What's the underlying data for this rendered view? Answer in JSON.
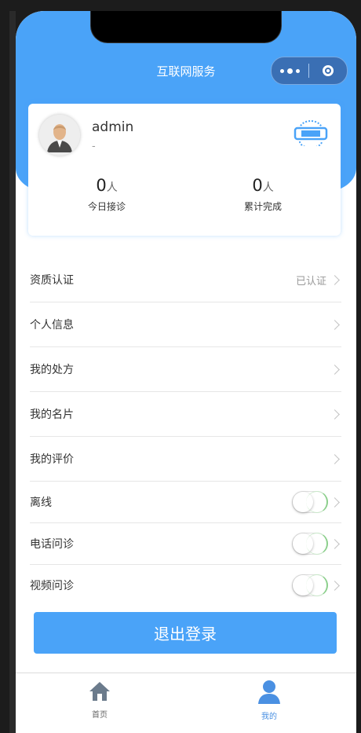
{
  "header": {
    "title": "互联网服务"
  },
  "capsule": {
    "more_icon": "more-dots-icon",
    "close_icon": "target-circle-icon"
  },
  "profile": {
    "username": "admin",
    "subtitle": "-",
    "badge_icon": "verified-badge-icon",
    "stats": [
      {
        "value": "0",
        "unit": "人",
        "label": "今日接诊"
      },
      {
        "value": "0",
        "unit": "人",
        "label": "累计完成"
      }
    ]
  },
  "menu": {
    "items": [
      {
        "label": "资质认证",
        "value": "已认证"
      },
      {
        "label": "个人信息"
      },
      {
        "label": "我的处方"
      },
      {
        "label": "我的名片"
      },
      {
        "label": "我的评价"
      },
      {
        "label": "离线"
      },
      {
        "label": "电话问诊"
      },
      {
        "label": "视频问诊"
      }
    ]
  },
  "logout": {
    "label": "退出登录"
  },
  "tabbar": {
    "items": [
      {
        "label": "首页",
        "icon": "home-icon",
        "color": "#666666"
      },
      {
        "label": "我的",
        "icon": "user-icon",
        "color": "#4a90e2"
      }
    ]
  },
  "colors": {
    "primary": "#4aa3f8",
    "active_tab": "#4a90e2",
    "switch_edge": "#8cd08c"
  }
}
